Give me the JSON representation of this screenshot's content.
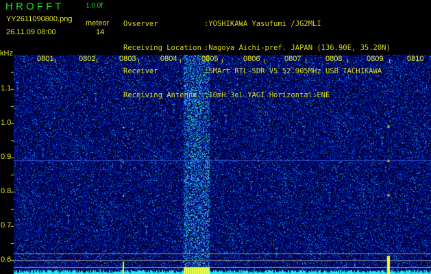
{
  "header": {
    "app_name": "H R O F F T",
    "version": "1.0.0f",
    "filename": "YY2611090800.png",
    "datetime": "26.11.09 08:00",
    "meteor_label": "meteor",
    "meteor_count": "14"
  },
  "info": [
    {
      "label": "Ovserver",
      "value": ":YOSHIKAWA Yasufumi /JG2MLI"
    },
    {
      "label": "Receiving Location",
      "value": ":Nagoya Aichi-pref. JAPAN (136.90E, 35.20N)"
    },
    {
      "label": "Receiver",
      "value": ":SMArt RTL-SDR V5 52.905MHz USB TACHIKAWA"
    },
    {
      "label": "Receiving Antenna",
      "value": ":10mH 3el.YAGI Horizontal:ENE"
    }
  ],
  "axis": {
    "unit": "kHz",
    "y_ticks": [
      "1.1",
      "1.0",
      "0.9",
      "0.8",
      "0.7",
      "0.6"
    ],
    "x_ticks": [
      "0801",
      "0802",
      "0803",
      "0804",
      "0805",
      "0806",
      "0807",
      "0808",
      "0809",
      "0810"
    ]
  },
  "colors": {
    "title": "#20e020",
    "text": "#e8e820",
    "background": "#000000"
  }
}
